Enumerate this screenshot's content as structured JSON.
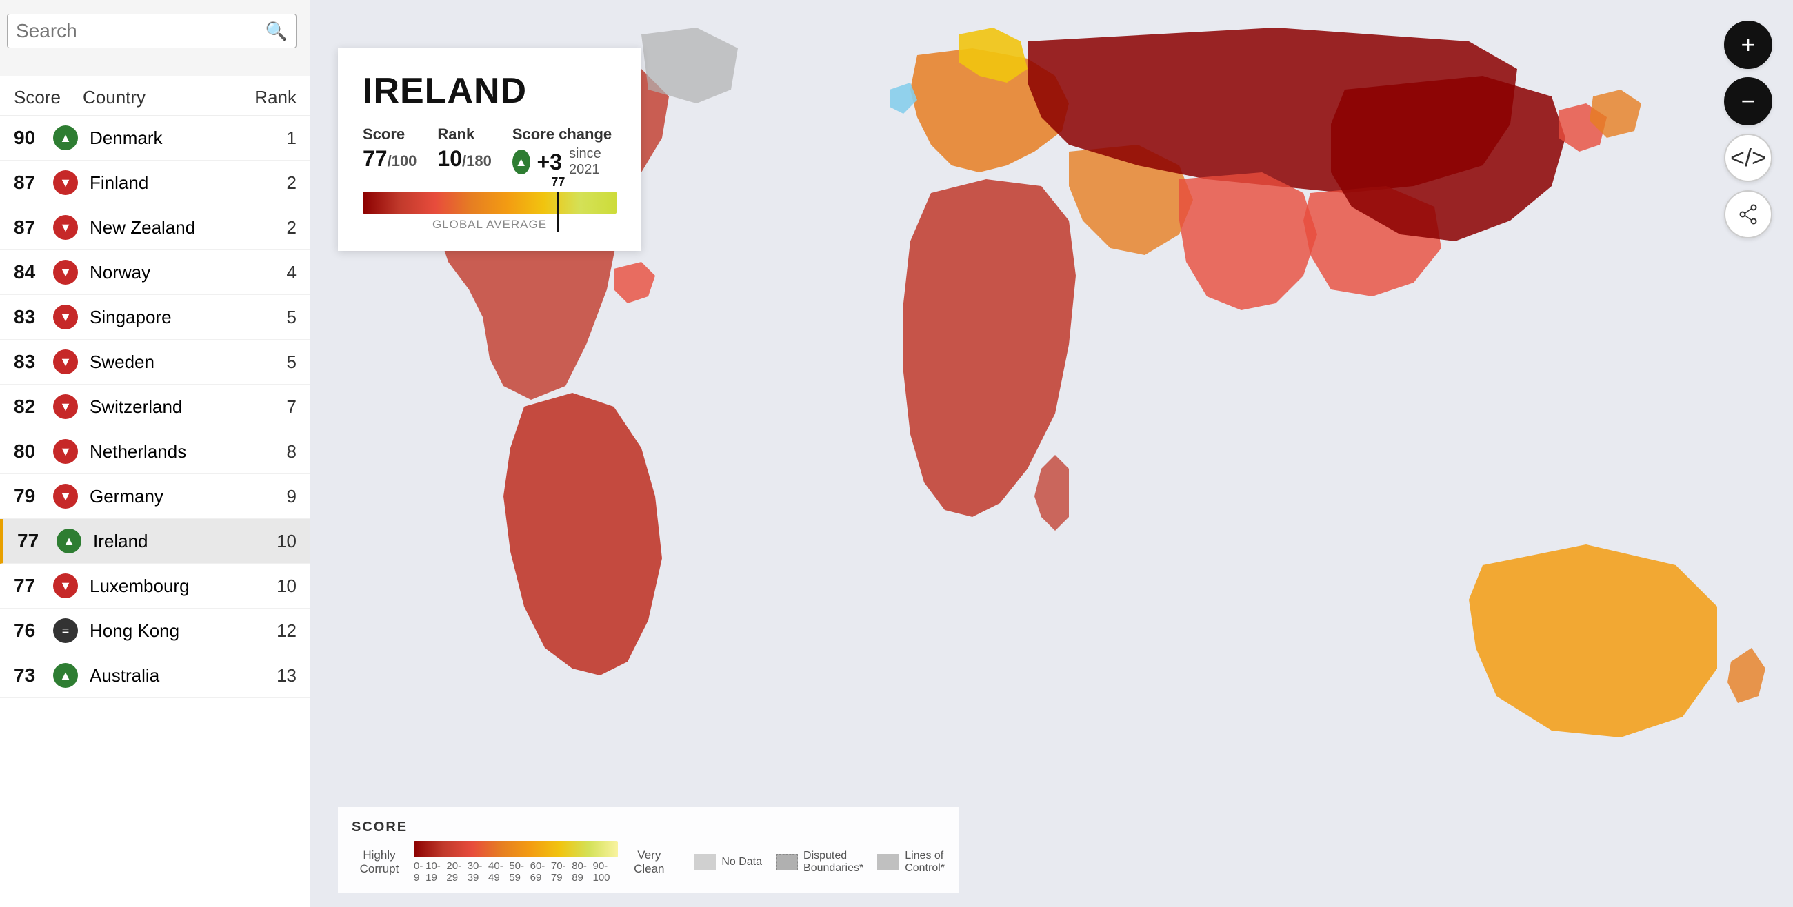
{
  "search": {
    "placeholder": "Search",
    "label": "Search"
  },
  "table": {
    "col_score": "Score",
    "col_country": "Country",
    "col_rank": "Rank",
    "rows": [
      {
        "score": "90",
        "trend": "up",
        "country": "Denmark",
        "rank": "1",
        "selected": false
      },
      {
        "score": "87",
        "trend": "down",
        "country": "Finland",
        "rank": "2",
        "selected": false
      },
      {
        "score": "87",
        "trend": "down",
        "country": "New Zealand",
        "rank": "2",
        "selected": false
      },
      {
        "score": "84",
        "trend": "down",
        "country": "Norway",
        "rank": "4",
        "selected": false
      },
      {
        "score": "83",
        "trend": "down",
        "country": "Singapore",
        "rank": "5",
        "selected": false
      },
      {
        "score": "83",
        "trend": "down",
        "country": "Sweden",
        "rank": "5",
        "selected": false
      },
      {
        "score": "82",
        "trend": "down",
        "country": "Switzerland",
        "rank": "7",
        "selected": false
      },
      {
        "score": "80",
        "trend": "down",
        "country": "Netherlands",
        "rank": "8",
        "selected": false
      },
      {
        "score": "79",
        "trend": "down",
        "country": "Germany",
        "rank": "9",
        "selected": false
      },
      {
        "score": "77",
        "trend": "up",
        "country": "Ireland",
        "rank": "10",
        "selected": true
      },
      {
        "score": "77",
        "trend": "down",
        "country": "Luxembourg",
        "rank": "10",
        "selected": false
      },
      {
        "score": "76",
        "trend": "neutral",
        "country": "Hong Kong",
        "rank": "12",
        "selected": false
      },
      {
        "score": "73",
        "trend": "up",
        "country": "Australia",
        "rank": "13",
        "selected": false
      }
    ]
  },
  "popup": {
    "country": "IRELAND",
    "score_label": "Score",
    "score_value": "77",
    "score_denom": "/100",
    "rank_label": "Rank",
    "rank_value": "10",
    "rank_denom": "/180",
    "change_label": "Score change",
    "change_value": "+3",
    "change_since": "since 2021",
    "score_marker": "77",
    "global_avg_label": "GLOBAL AVERAGE"
  },
  "controls": {
    "zoom_in": "+",
    "zoom_out": "−",
    "embed": "</>",
    "share": "⬡"
  },
  "legend": {
    "title": "SCORE",
    "label_left": "Highly\nCorrupt",
    "label_right": "Very\nClean",
    "ticks": [
      "0-9",
      "10-19",
      "20-29",
      "30-39",
      "40-49",
      "50-59",
      "60-69",
      "70-79",
      "80-89",
      "90-100"
    ],
    "no_data_label": "No Data",
    "disputed_label": "Disputed\nBoundaries*",
    "lines_label": "Lines of\nControl*"
  }
}
